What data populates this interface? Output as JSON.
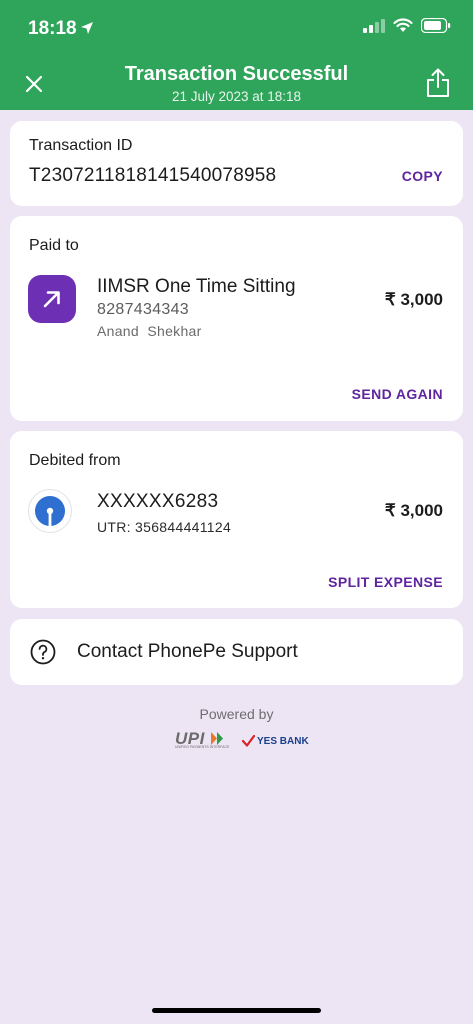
{
  "status_bar": {
    "time": "18:18"
  },
  "header": {
    "title": "Transaction Successful",
    "subtitle": "21 July 2023 at 18:18",
    "close_icon": "close-icon",
    "share_icon": "share-icon",
    "background": "#2ea55a"
  },
  "transaction": {
    "label": "Transaction ID",
    "id": "T2307211818141540078958",
    "copy_label": "COPY"
  },
  "paid_to": {
    "label": "Paid to",
    "name": "IIMSR One Time Sitting",
    "phone": "8287434343",
    "person": "Anand  Shekhar",
    "amount": "₹ 3,000",
    "action_label": "SEND AGAIN",
    "icon": "arrow-up-right-icon",
    "icon_color": "#6d2fb3"
  },
  "debited_from": {
    "label": "Debited from",
    "account": "XXXXXX6283",
    "utr": "UTR: 356844441124",
    "amount": "₹ 3,000",
    "action_label": "SPLIT EXPENSE",
    "icon": "bank-logo"
  },
  "support": {
    "label": "Contact PhonePe Support",
    "icon": "question-circle-icon"
  },
  "footer": {
    "powered_by": "Powered by",
    "upi_logo_text": "UPI",
    "upi_logo_subtext": "UNIFIED PAYMENTS INTERFACE",
    "bank_logo_text": "YES BANK"
  },
  "colors": {
    "accent": "#5f259f",
    "page_background": "#ede5f4",
    "header_green": "#2ea55a"
  }
}
